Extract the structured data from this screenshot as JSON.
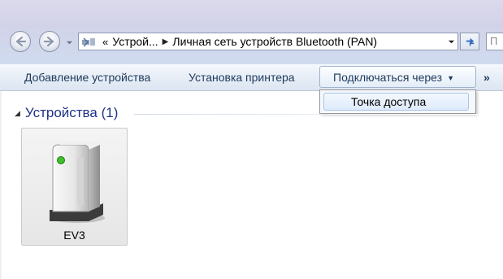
{
  "address_bar": {
    "overflow": "«",
    "crumb1": "Устрой...",
    "crumb2": "Личная сеть устройств Bluetooth (PAN)",
    "search_placeholder": "П"
  },
  "toolbar": {
    "add_device": "Добавление устройства",
    "add_printer": "Установка принтера",
    "connect_via": "Подключаться через",
    "more": "»"
  },
  "menu": {
    "items": [
      "Точка доступа"
    ]
  },
  "devices_group": {
    "title": "Устройства (1)",
    "items": [
      {
        "label": "EV3",
        "icon": "network-device-icon"
      }
    ]
  },
  "icons": {
    "back": "back-arrow-icon",
    "forward": "forward-arrow-icon",
    "bluetooth": "bluetooth-icon",
    "refresh": "refresh-icon"
  },
  "colors": {
    "command_text": "#1e395b",
    "group_title": "#1e3287",
    "menu_highlight": "#dfeafb"
  }
}
